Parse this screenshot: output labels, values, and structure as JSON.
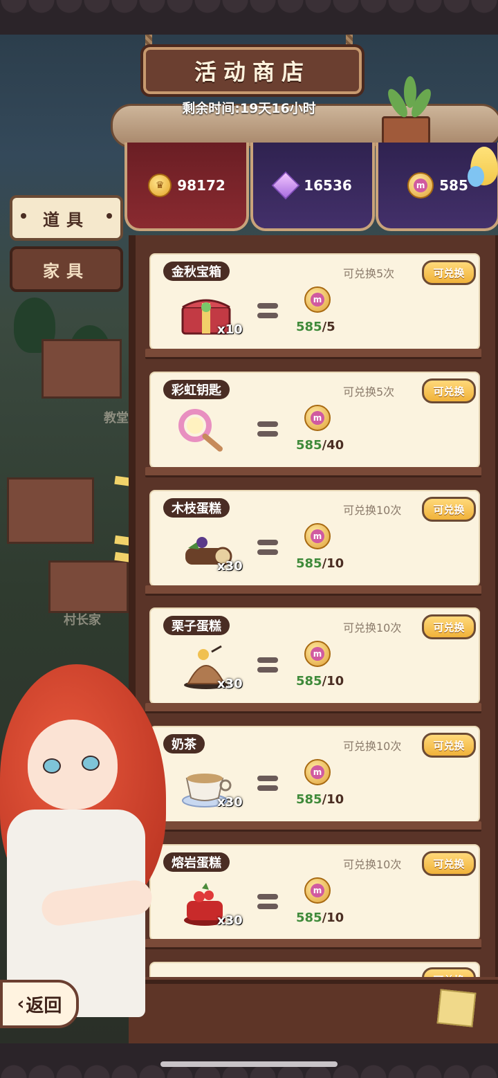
{
  "header": {
    "title": "活动商店",
    "timer": "剩余时间:19天16小时"
  },
  "currencies": [
    {
      "icon": "gold-coin-icon",
      "value": "98172"
    },
    {
      "icon": "purple-gem-icon",
      "value": "16536"
    },
    {
      "icon": "event-coin-icon",
      "value": "585"
    }
  ],
  "tabs": {
    "props": "道具",
    "furniture": "家具"
  },
  "items": [
    {
      "name": "金秋宝箱",
      "limit": "可兑换5次",
      "button": "可兑换",
      "qty": "x10",
      "have": "585",
      "cost": "/5",
      "icon": "treasure-chest-icon"
    },
    {
      "name": "彩虹钥匙",
      "limit": "可兑换5次",
      "button": "可兑换",
      "qty": "",
      "have": "585",
      "cost": "/40",
      "icon": "rainbow-key-icon"
    },
    {
      "name": "木枝蛋糕",
      "limit": "可兑换10次",
      "button": "可兑换",
      "qty": "x30",
      "have": "585",
      "cost": "/10",
      "icon": "log-cake-icon"
    },
    {
      "name": "栗子蛋糕",
      "limit": "可兑换10次",
      "button": "可兑换",
      "qty": "x30",
      "have": "585",
      "cost": "/10",
      "icon": "chestnut-cake-icon"
    },
    {
      "name": "奶茶",
      "limit": "可兑换10次",
      "button": "可兑换",
      "qty": "x30",
      "have": "585",
      "cost": "/10",
      "icon": "milk-tea-icon"
    },
    {
      "name": "熔岩蛋糕",
      "limit": "可兑换10次",
      "button": "可兑换",
      "qty": "x30",
      "have": "585",
      "cost": "/10",
      "icon": "lava-cake-icon"
    }
  ],
  "back_button": "返回",
  "map_labels": {
    "church": "教堂",
    "chief": "村长家"
  },
  "colors": {
    "have_green": "#3f8a3a",
    "button_gold": "#f0b23a"
  }
}
